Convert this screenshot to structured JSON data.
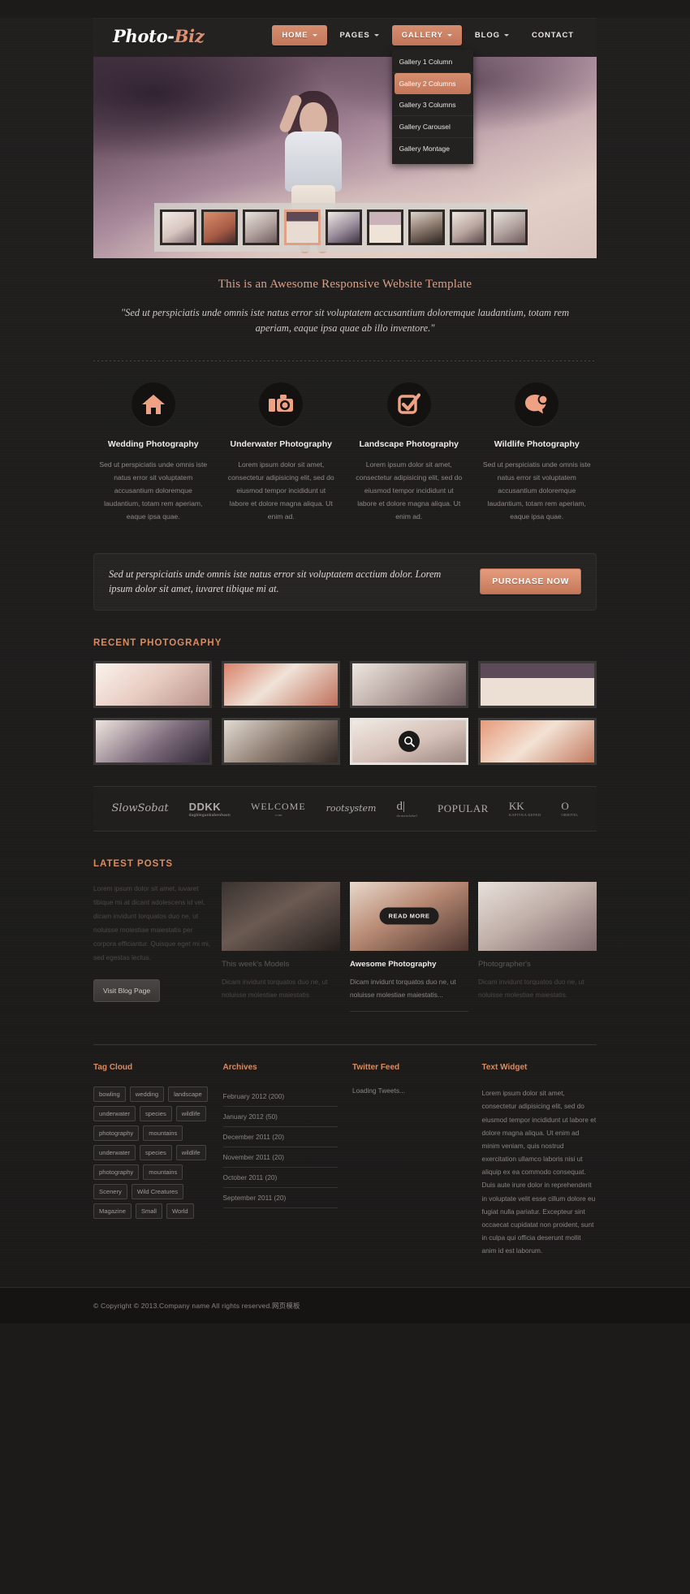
{
  "header": {
    "logo_photo": "Photo-",
    "logo_biz": "Biz",
    "nav": [
      {
        "label": "HOME",
        "has_caret": true,
        "active": true
      },
      {
        "label": "PAGES",
        "has_caret": true,
        "active": false
      },
      {
        "label": "GALLERY",
        "has_caret": true,
        "active": true
      },
      {
        "label": "BLOG",
        "has_caret": true,
        "active": false
      },
      {
        "label": "CONTACT",
        "has_caret": false,
        "active": false
      }
    ],
    "gallery_dropdown": [
      {
        "label": "Gallery 1 Column",
        "selected": false
      },
      {
        "label": "Gallery 2 Columns",
        "selected": true
      },
      {
        "label": "Gallery 3 Columns",
        "selected": false
      },
      {
        "label": "Gallery Carousel",
        "selected": false
      },
      {
        "label": "Gallery Montage",
        "selected": false
      }
    ]
  },
  "tagline": {
    "heading": "This is an Awesome Responsive Website Template",
    "quote": "\"Sed ut perspiciatis unde omnis iste natus error sit voluptatem accusantium doloremque laudantium, totam rem aperiam, eaque ipsa quae ab illo inventore.\""
  },
  "services": [
    {
      "icon": "home-icon",
      "title": "Wedding Photography",
      "text": "Sed ut perspiciatis unde omnis iste natus error sit voluptatem accusantium doloremque laudantium, totam rem aperiam, eaque ipsa quae."
    },
    {
      "icon": "camera-icon",
      "title": "Underwater Photography",
      "text": "Lorem ipsum dolor sit amet, consectetur adipisicing elit, sed do eiusmod tempor incididunt ut labore et dolore magna aliqua. Ut enim ad."
    },
    {
      "icon": "checkbox-icon",
      "title": "Landscape Photography",
      "text": "Lorem ipsum dolor sit amet, consectetur adipisicing elit, sed do eiusmod tempor incididunt ut labore et dolore magna aliqua. Ut enim ad."
    },
    {
      "icon": "chat-bubble-icon",
      "title": "Wildlife Photography",
      "text": "Sed ut perspiciatis unde omnis iste natus error sit voluptatem accusantium doloremque laudantium, totam rem aperiam, eaque ipsa quae."
    }
  ],
  "cta": {
    "text": "Sed ut perspiciatis unde omnis iste natus error sit voluptatem acctium dolor. Lorem ipsum dolor sit amet, iuvaret tibique mi at.",
    "button": "PURCHASE NOW"
  },
  "recent": {
    "heading": "RECENT PHOTOGRAPHY",
    "items": [
      {
        "style": "p1",
        "highlight": false
      },
      {
        "style": "p2",
        "highlight": false
      },
      {
        "style": "p3",
        "highlight": false
      },
      {
        "style": "p4",
        "highlight": false
      },
      {
        "style": "p5",
        "highlight": false
      },
      {
        "style": "p6",
        "highlight": false
      },
      {
        "style": "p7",
        "highlight": true
      },
      {
        "style": "p8",
        "highlight": false
      }
    ]
  },
  "clients": [
    {
      "name": "SlowSobat",
      "cls": "c-slow",
      "sub": ""
    },
    {
      "name": "DDKK",
      "cls": "c-ddkk",
      "sub": "dagblegankabenhavn"
    },
    {
      "name": "WELCOME",
      "cls": "c-welcome",
      "sub": ".com"
    },
    {
      "name": "rootsystem",
      "cls": "c-root",
      "sub": ""
    },
    {
      "name": "d|",
      "cls": "c-dl",
      "sub": "domainlabel"
    },
    {
      "name": "POPULAR",
      "cls": "c-popular",
      "sub": ""
    },
    {
      "name": "KK",
      "cls": "c-kk",
      "sub": "KAPIVKA KEPEH"
    },
    {
      "name": "O",
      "cls": "c-orbitel",
      "sub": "ORBITEL"
    }
  ],
  "latest": {
    "heading": "LATEST POSTS",
    "intro": "Lorem ipsum dolor sit amet, iuvaret tibique mi at dicant adolescens id vel, dicam invidunt torquatos duo ne, ut noluisse molestiae maiestatis per corpora efficiantur. Quisque eget mi mi, sed egestas lectus.",
    "blog_button": "Visit Blog Page",
    "posts": [
      {
        "thumb": "pt1",
        "title": "This week's Models",
        "excerpt": "Dicam invidunt torquatos duo ne, ut noluisse molestiae maiestatis.",
        "state": "dim",
        "read_more": ""
      },
      {
        "thumb": "pt2",
        "title": "Awesome Photography",
        "excerpt": "Dicam invidunt torquatos duo ne, ut noluisse molestiae maiestatis...",
        "state": "on",
        "read_more": "READ MORE"
      },
      {
        "thumb": "pt3",
        "title": "Photographer's",
        "excerpt": "Dicam invidunt torquatos duo ne, ut noluisse molestiae maiestatis.",
        "state": "dim",
        "read_more": ""
      }
    ]
  },
  "widgets": {
    "tag_cloud": {
      "title": "Tag Cloud",
      "tags": [
        "bowling",
        "wedding",
        "landscape",
        "underwater",
        "species",
        "wildlife",
        "photography",
        "mountains",
        "underwater",
        "species",
        "wildlife",
        "photography",
        "mountains",
        "Scenery",
        "Wild Creatures",
        "Magazine",
        "Small",
        "World"
      ]
    },
    "archives": {
      "title": "Archives",
      "items": [
        "February 2012 (200)",
        "January 2012 (50)",
        "December 2011 (20)",
        "November 2011 (20)",
        "October 2011 (20)",
        "September 2011 (20)"
      ]
    },
    "twitter": {
      "title": "Twitter Feed",
      "status": "Loading Tweets..."
    },
    "text_widget": {
      "title": "Text Widget",
      "body": "Lorem ipsum dolor sit amet, consectetur adipisicing elit, sed do eiusmod tempor incididunt ut labore et dolore magna aliqua. Ut enim ad minim veniam, quis nostrud exercitation ullamco laboris nisi ut aliquip ex ea commodo consequat. Duis aute irure dolor in reprehenderit in voluptate velit esse cillum dolore eu fugiat nulla pariatur. Excepteur sint occaecat cupidatat non proident, sunt in culpa qui officia deserunt mollit anim id est laborum."
    }
  },
  "footer": {
    "copyright": "© Copyright © 2013.Company name All rights reserved.网页模板"
  },
  "colors": {
    "accent": "#d98c63",
    "button": "#c4785a",
    "bg": "#1c1b1a",
    "panel": "#232221"
  }
}
